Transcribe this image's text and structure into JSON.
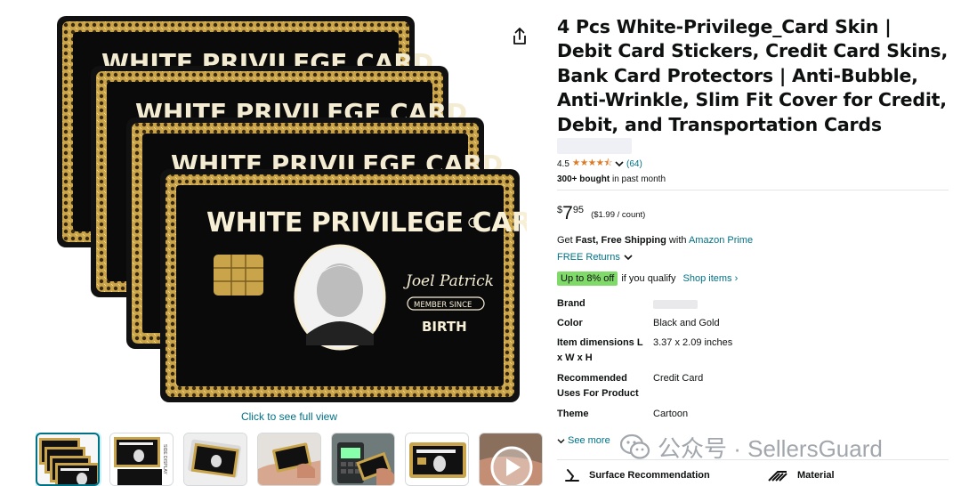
{
  "product": {
    "title": "4 Pcs White-Privilege_Card Skin | Debit Card Stickers, Credit Card Skins, Bank Card Protectors | Anti-Bubble, Anti-Wrinkle, Slim Fit Cover for Credit, Debit, and Transportation Cards",
    "rating": "4.5",
    "stars": "★★★★⯪",
    "rating_count": "(64)",
    "bought_bold": "300+ bought",
    "bought_rest": " in past month",
    "price": {
      "symbol": "$",
      "whole": "7",
      "fraction": "95",
      "unit_price": "($1.99 / count)"
    },
    "shipping": {
      "prefix": "Get ",
      "bold": "Fast, Free Shipping",
      "middle": " with ",
      "link": "Amazon Prime"
    },
    "returns": "FREE Returns",
    "offer": {
      "badge": "Up to 8% off",
      "text": "if you qualify",
      "link": "Shop items ›"
    },
    "specs": [
      {
        "label": "Brand",
        "value": ""
      },
      {
        "label": "Color",
        "value": "Black and Gold"
      },
      {
        "label": "Item dimensions L x W x H",
        "value": "3.37 x 2.09 inches"
      },
      {
        "label": "Recommended Uses For Product",
        "value": "Credit Card"
      },
      {
        "label": "Theme",
        "value": "Cartoon"
      }
    ],
    "see_more": "See more",
    "features": [
      {
        "icon": "surface-recommendation-icon",
        "label": "Surface Recommendation"
      },
      {
        "icon": "material-icon",
        "label": "Material"
      }
    ]
  },
  "gallery": {
    "see_full_view": "Click to see full view",
    "card_text": "WHITE PRIVILEGE CARD",
    "card_signature": "Joel Patrick",
    "card_ribbon": "MEMBER SINCE",
    "card_birth": "BIRTH",
    "thumbnails": [
      "card-stack",
      "card-display",
      "card-sticker",
      "card-hand",
      "card-pos",
      "card-single",
      "video"
    ]
  },
  "watermark": {
    "text": "公众号 · SellersGuard"
  },
  "colors": {
    "link": "#007185",
    "star": "#de7921",
    "offer_badge": "#7fda69",
    "card_gold": "#c9a44a",
    "card_black": "#0a0a0a"
  }
}
